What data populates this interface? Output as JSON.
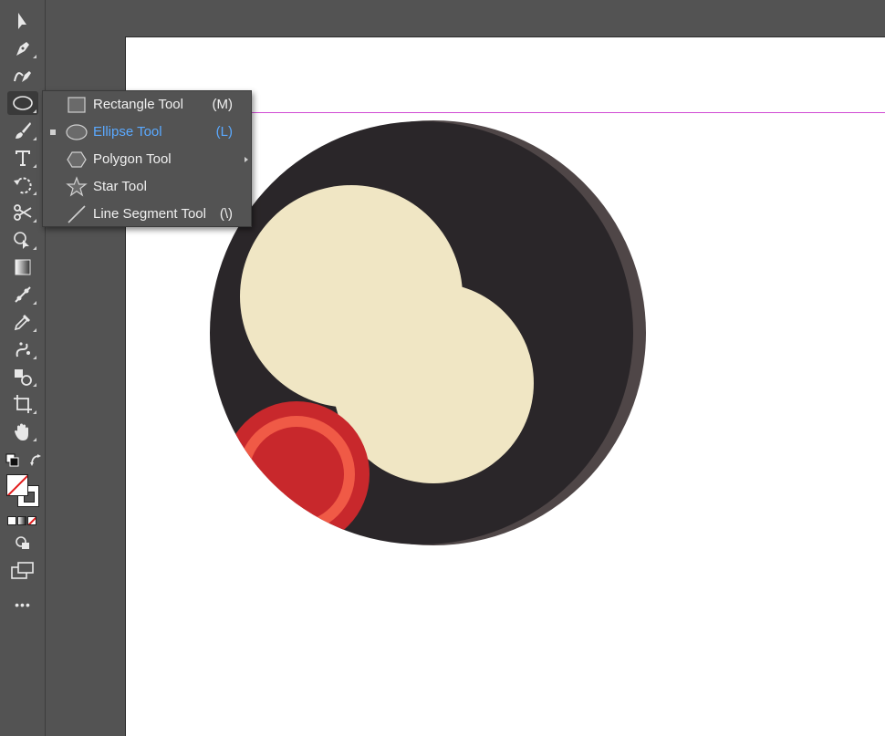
{
  "toolbar": {
    "tools": [
      {
        "icon": "selection-arrow-icon"
      },
      {
        "icon": "pen-icon"
      },
      {
        "icon": "curvature-icon"
      },
      {
        "icon": "ellipse-icon"
      },
      {
        "icon": "paintbrush-icon"
      },
      {
        "icon": "type-icon"
      },
      {
        "icon": "rotate-icon"
      },
      {
        "icon": "scissors-icon"
      },
      {
        "icon": "shape-builder-icon"
      },
      {
        "icon": "gradient-icon"
      },
      {
        "icon": "blend-icon"
      },
      {
        "icon": "eyedropper-icon"
      },
      {
        "icon": "symbol-sprayer-icon"
      },
      {
        "icon": "shape-group-icon"
      },
      {
        "icon": "artboard-icon"
      },
      {
        "icon": "hand-icon"
      }
    ],
    "fill_stroke": {
      "fill": "none",
      "stroke": "#ffffff"
    },
    "more_label": "•••"
  },
  "flyout": {
    "items": [
      {
        "label": "Rectangle Tool",
        "shortcut": "(M)",
        "icon": "rectangle-icon"
      },
      {
        "label": "Ellipse Tool",
        "shortcut": "(L)",
        "icon": "ellipse-icon",
        "selected": true
      },
      {
        "label": "Polygon Tool",
        "shortcut": "",
        "icon": "polygon-icon"
      },
      {
        "label": "Star Tool",
        "shortcut": "",
        "icon": "star-icon"
      },
      {
        "label": "Line Segment Tool",
        "shortcut": "(\\)",
        "icon": "line-segment-icon"
      }
    ]
  },
  "colors": {
    "ui_background": "#535353",
    "artboard": "#ffffff",
    "selected_text": "#5aa9ff",
    "guide": "#d04ad4",
    "art_dark": "#2a2629",
    "art_rim": "#4f4647",
    "art_cream": "#f0e6c4",
    "art_red": "#c8282c",
    "art_orange": "#f05a46"
  }
}
